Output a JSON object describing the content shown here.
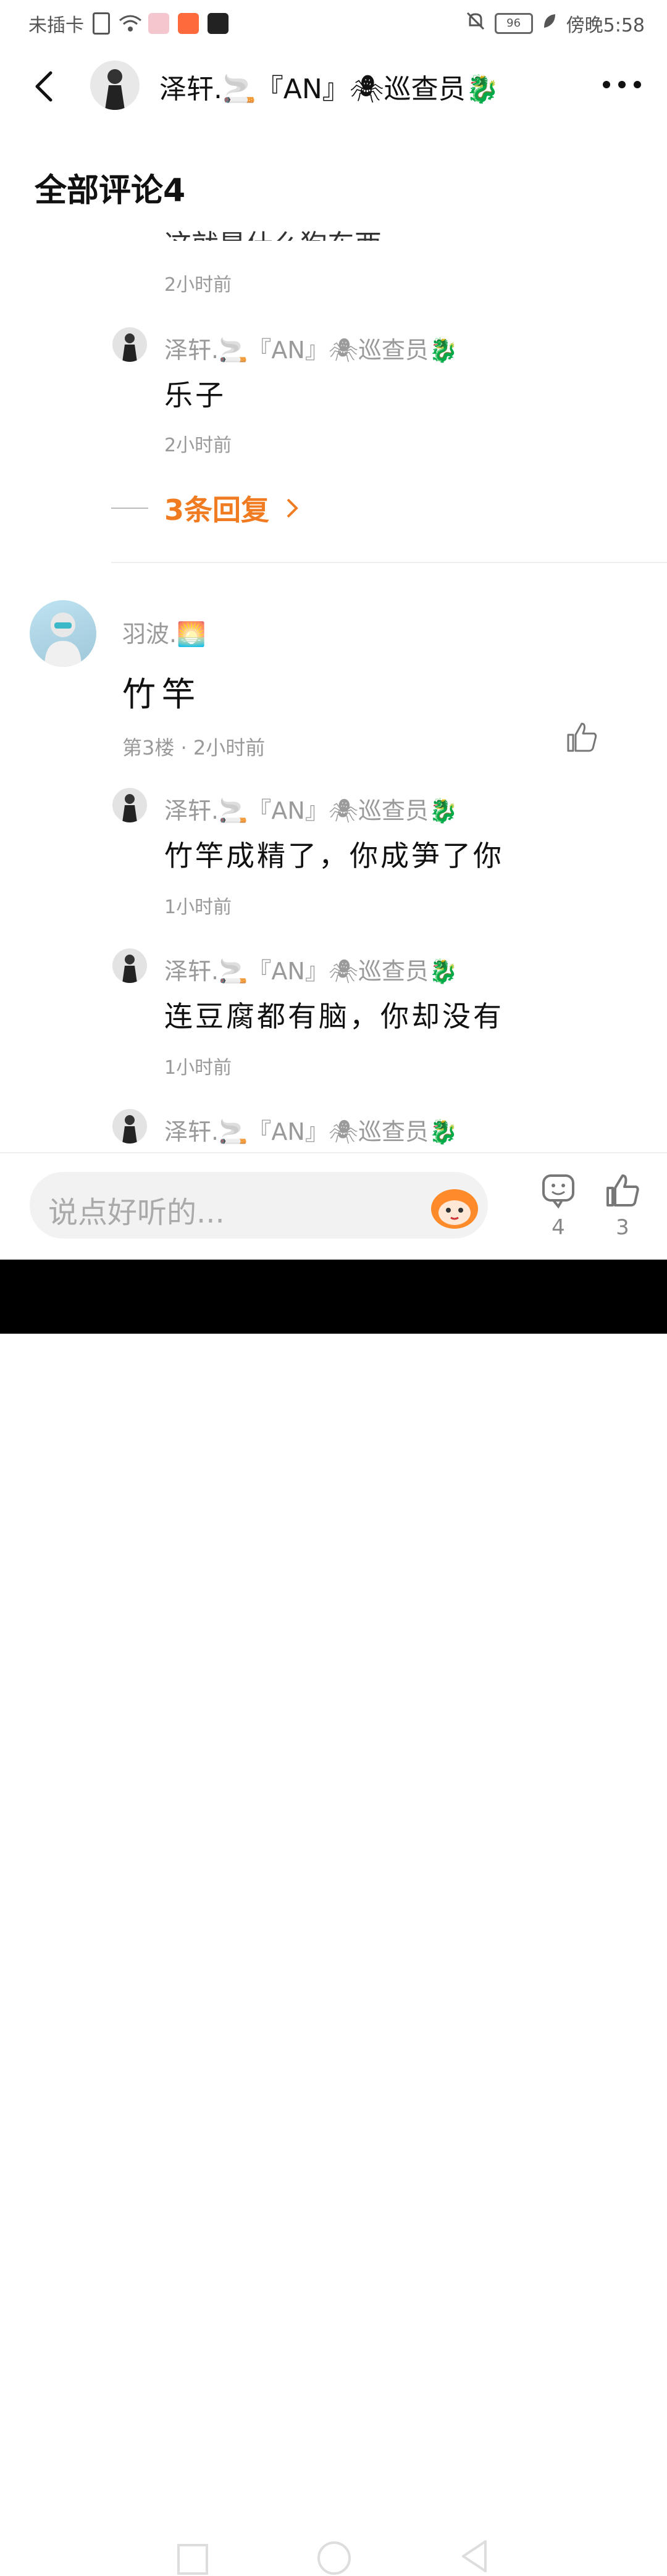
{
  "status_bar": {
    "left_text": "未插卡",
    "battery": "96",
    "time_text": "傍晚5:58"
  },
  "header": {
    "name": "泽轩.🚬『AN』🕷巡查员🐉"
  },
  "section_title": "全部评论4",
  "cut_text": "这就是什么狗东西",
  "replies_top": [
    {
      "time": "2小时前"
    },
    {
      "name": "泽轩.🚬『AN』🕷巡查员🐉",
      "text": "乐子",
      "time": "2小时前"
    }
  ],
  "more_replies": "3条回复",
  "comment": {
    "name": "羽波.🌅",
    "text": "竹竿",
    "meta": "第3楼 · 2小时前",
    "replies": [
      {
        "name": "泽轩.🚬『AN』🕷巡查员🐉",
        "text": "竹竿成精了，你成笋了你",
        "time": "1小时前"
      },
      {
        "name": "泽轩.🚬『AN』🕷巡查员🐉",
        "text": "连豆腐都有脑，你却没有",
        "time": "1小时前"
      },
      {
        "name": "泽轩.🚬『AN』🕷巡查员🐉"
      }
    ]
  },
  "bottom": {
    "placeholder": "说点好听的...",
    "comment_count": "4",
    "like_count": "3"
  },
  "icons": {
    "back": "chevron-left-icon",
    "more": "more-dots-icon",
    "like": "thumbs-up-icon",
    "comment": "comment-smile-icon",
    "mascot": "mascot-emoji-icon"
  },
  "colors": {
    "accent": "#f07b20",
    "nav_bg": "#000000"
  }
}
